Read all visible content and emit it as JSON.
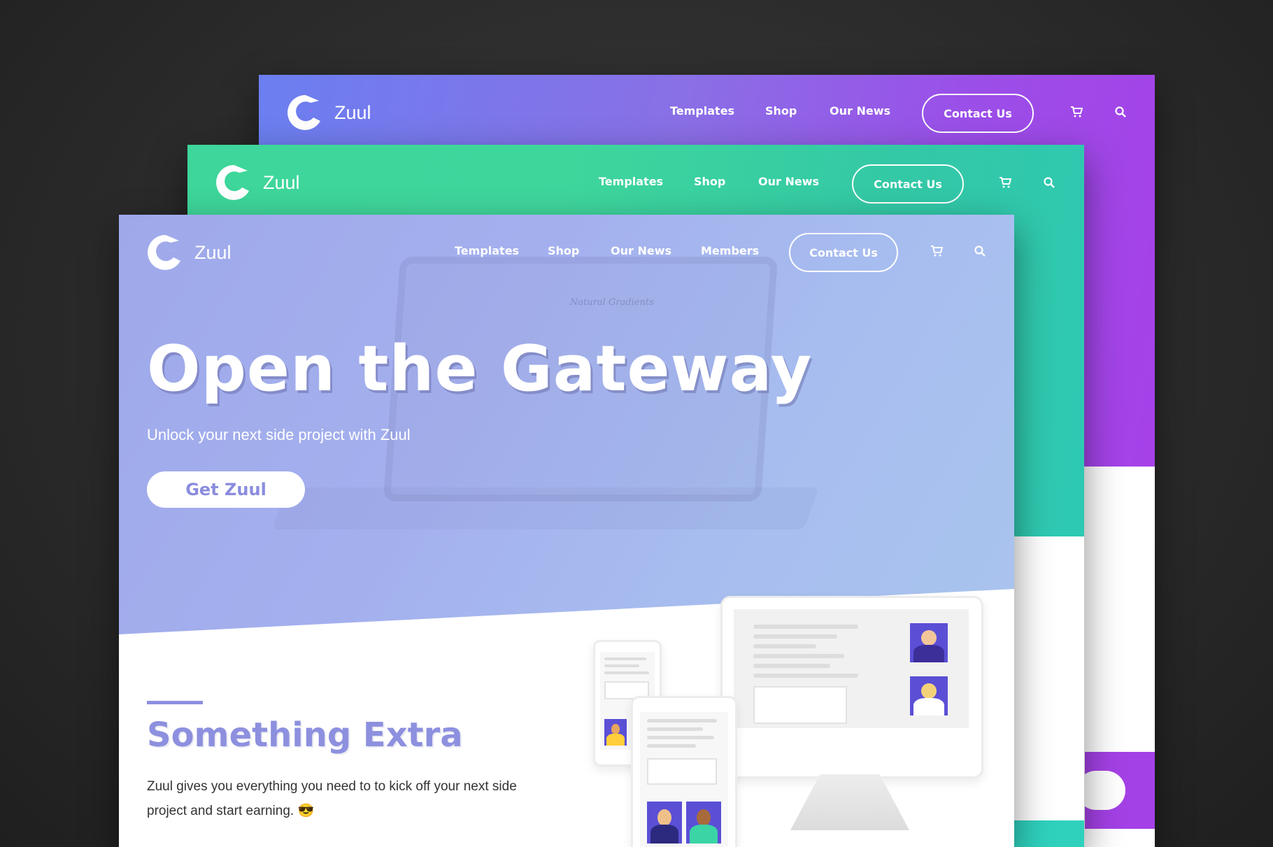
{
  "brand": {
    "name": "Zuul"
  },
  "nav_back": {
    "links": [
      "Templates",
      "Shop",
      "Our News"
    ],
    "contact_label": "Contact Us",
    "color": "#8a6fe6"
  },
  "nav_mid": {
    "links": [
      "Templates",
      "Shop",
      "Our News"
    ],
    "contact_label": "Contact Us",
    "color": "#3ed69a"
  },
  "nav_front": {
    "links": [
      "Templates",
      "Shop",
      "Our News",
      "Members"
    ],
    "contact_label": "Contact Us",
    "color": "#a4b0ee"
  },
  "icons": {
    "cart": "cart-icon",
    "search": "search-icon",
    "logo": "zuul-logo-icon"
  },
  "hero": {
    "title": "Open the Gateway",
    "subtitle": "Unlock your next side project with Zuul",
    "cta_label": "Get Zuul",
    "ghost_label": "Natural Gradients"
  },
  "section": {
    "title": "Something Extra",
    "body": "Zuul gives you everything you need to to kick off your next side project and start earning. 😎",
    "accent_color": "#8d8fe0"
  }
}
